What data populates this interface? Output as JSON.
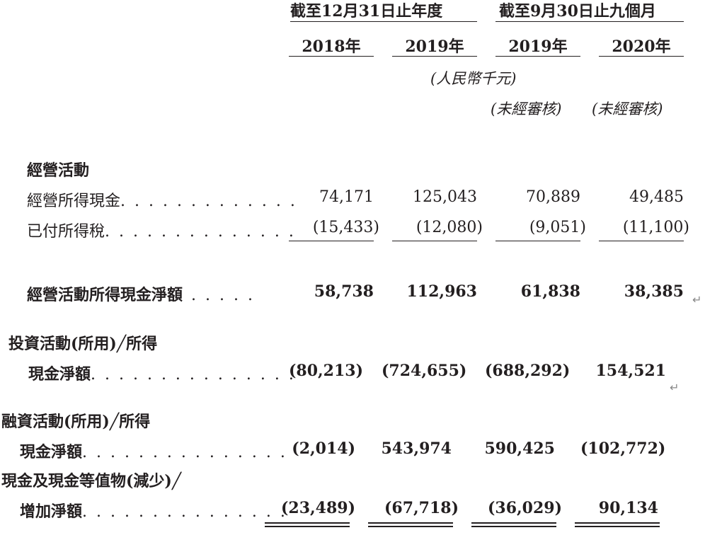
{
  "header": {
    "period1": "截至12月31日止年度",
    "period2": "截至9月30日止九個月",
    "years": [
      "2018年",
      "2019年",
      "2019年",
      "2020年"
    ],
    "currency": "(人民幣千元)",
    "unaudited1": "(未經審核)",
    "unaudited2": "(未經審核)"
  },
  "sections": {
    "operating_title": "經營活動"
  },
  "rows": [
    {
      "label": "經營所得現金",
      "dots": ". . . . . . . . . . . . .",
      "values": [
        "74,171",
        "125,043",
        "70,889",
        "49,485"
      ]
    },
    {
      "label": "已付所得稅",
      "dots": ". . . . . . . . . . . . . .",
      "values": [
        "(15,433)",
        "(12,080)",
        "(9,051)",
        "(11,100)"
      ]
    },
    {
      "label": "經營活動所得現金淨額",
      "dots": ". . . . .",
      "values": [
        "58,738",
        "112,963",
        "61,838",
        "38,385"
      ]
    },
    {
      "label1": "投資活動(所用)╱所得",
      "label": "現金淨額",
      "dots": ". . . . . . . . . . . . . . .",
      "values": [
        "(80,213)",
        "(724,655)",
        "(688,292)",
        "154,521"
      ]
    },
    {
      "label1": "融資活動(所用)╱所得",
      "label": "現金淨額",
      "dots": ". . . . . . . . . . . . . . .",
      "values": [
        "(2,014)",
        "543,974",
        "590,425",
        "(102,772)"
      ]
    },
    {
      "label1": "現金及現金等值物(減少)╱",
      "label": "增加淨額",
      "dots": ". . . . . . . . . . . . . . .",
      "values": [
        "(23,489)",
        "(67,718)",
        "(36,029)",
        "90,134"
      ]
    }
  ],
  "glyphs": {
    "return_mark": "↵"
  }
}
